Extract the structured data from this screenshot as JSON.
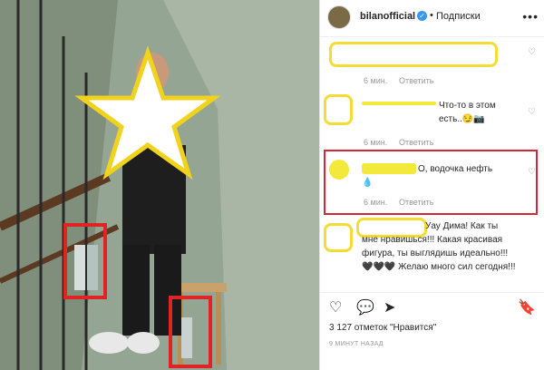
{
  "header": {
    "username": "bilanofficial",
    "separator": "•",
    "follow_label": "Подписки",
    "more_label": "•••"
  },
  "comments": [
    {
      "text": "",
      "time": "6 мин.",
      "reply": "Ответить"
    },
    {
      "text": "Что-то в этом есть..😏📷",
      "time": "6 мин.",
      "reply": "Ответить"
    },
    {
      "text": "О, водочка нефть",
      "emoji": "💧",
      "time": "6 мин.",
      "reply": "Ответить"
    },
    {
      "text": "Уау Дима! Как ты мне нравишься!!! Какая красивая фигура, ты выглядишь идеально!!! 🖤🖤🖤 Желаю много сил сегодня!!!"
    }
  ],
  "actions": {
    "like_icon": "heart-icon",
    "comment_icon": "comment-icon",
    "share_icon": "share-icon",
    "save_icon": "bookmark-icon"
  },
  "likes_text": "3 127 отметок \"Нравится\"",
  "post_time": "9 МИНУТ НАЗАД",
  "colors": {
    "highlight": "#f5dc35",
    "redbox": "#d0283a",
    "verified": "#3897f0"
  }
}
